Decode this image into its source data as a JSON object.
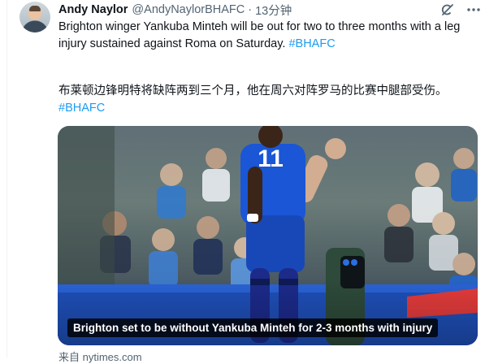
{
  "tweet": {
    "author_name": "Andy Naylor",
    "author_handle": "@AndyNaylorBHAFC",
    "separator": "·",
    "timestamp": "13分钟",
    "text_en": "Brighton winger Yankuba Minteh will be out for two to three months with a leg injury sustained against Roma on Saturday. ",
    "hashtag_en": "#BHAFC",
    "text_cn": "布莱顿边锋明特将缺阵两到三个月，他在周六对阵罗马的比赛中腿部受伤。",
    "hashtag_cn": "#BHAFC"
  },
  "card": {
    "caption": "Brighton set to be without Yankuba Minteh for 2-3 months with injury",
    "jersey_number": "11",
    "source": "来自 nytimes.com"
  },
  "icons": {
    "grok": "grok-icon",
    "more": "more-options-icon"
  },
  "colors": {
    "link": "#1d9bf0",
    "text": "#0f1419",
    "secondary": "#536471",
    "kit_blue": "#1a56d6"
  }
}
